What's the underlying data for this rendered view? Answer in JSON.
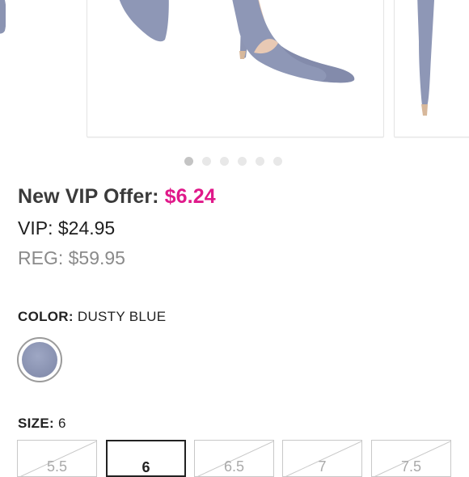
{
  "carousel": {
    "dots": 6,
    "active_index": 0
  },
  "pricing": {
    "offer_label": "New VIP Offer:",
    "offer_price": "$6.24",
    "vip_label": "VIP:",
    "vip_price": "$24.95",
    "reg_label": "REG:",
    "reg_price": "$59.95"
  },
  "color": {
    "label": "COLOR:",
    "value": "DUSTY BLUE",
    "swatch_color": "#8e97b6"
  },
  "size": {
    "label": "SIZE:",
    "value": "6",
    "options": [
      "5.5",
      "6",
      "6.5",
      "7",
      "7.5"
    ],
    "selected_index": 1
  },
  "colors": {
    "accent_pink": "#e0198a"
  }
}
